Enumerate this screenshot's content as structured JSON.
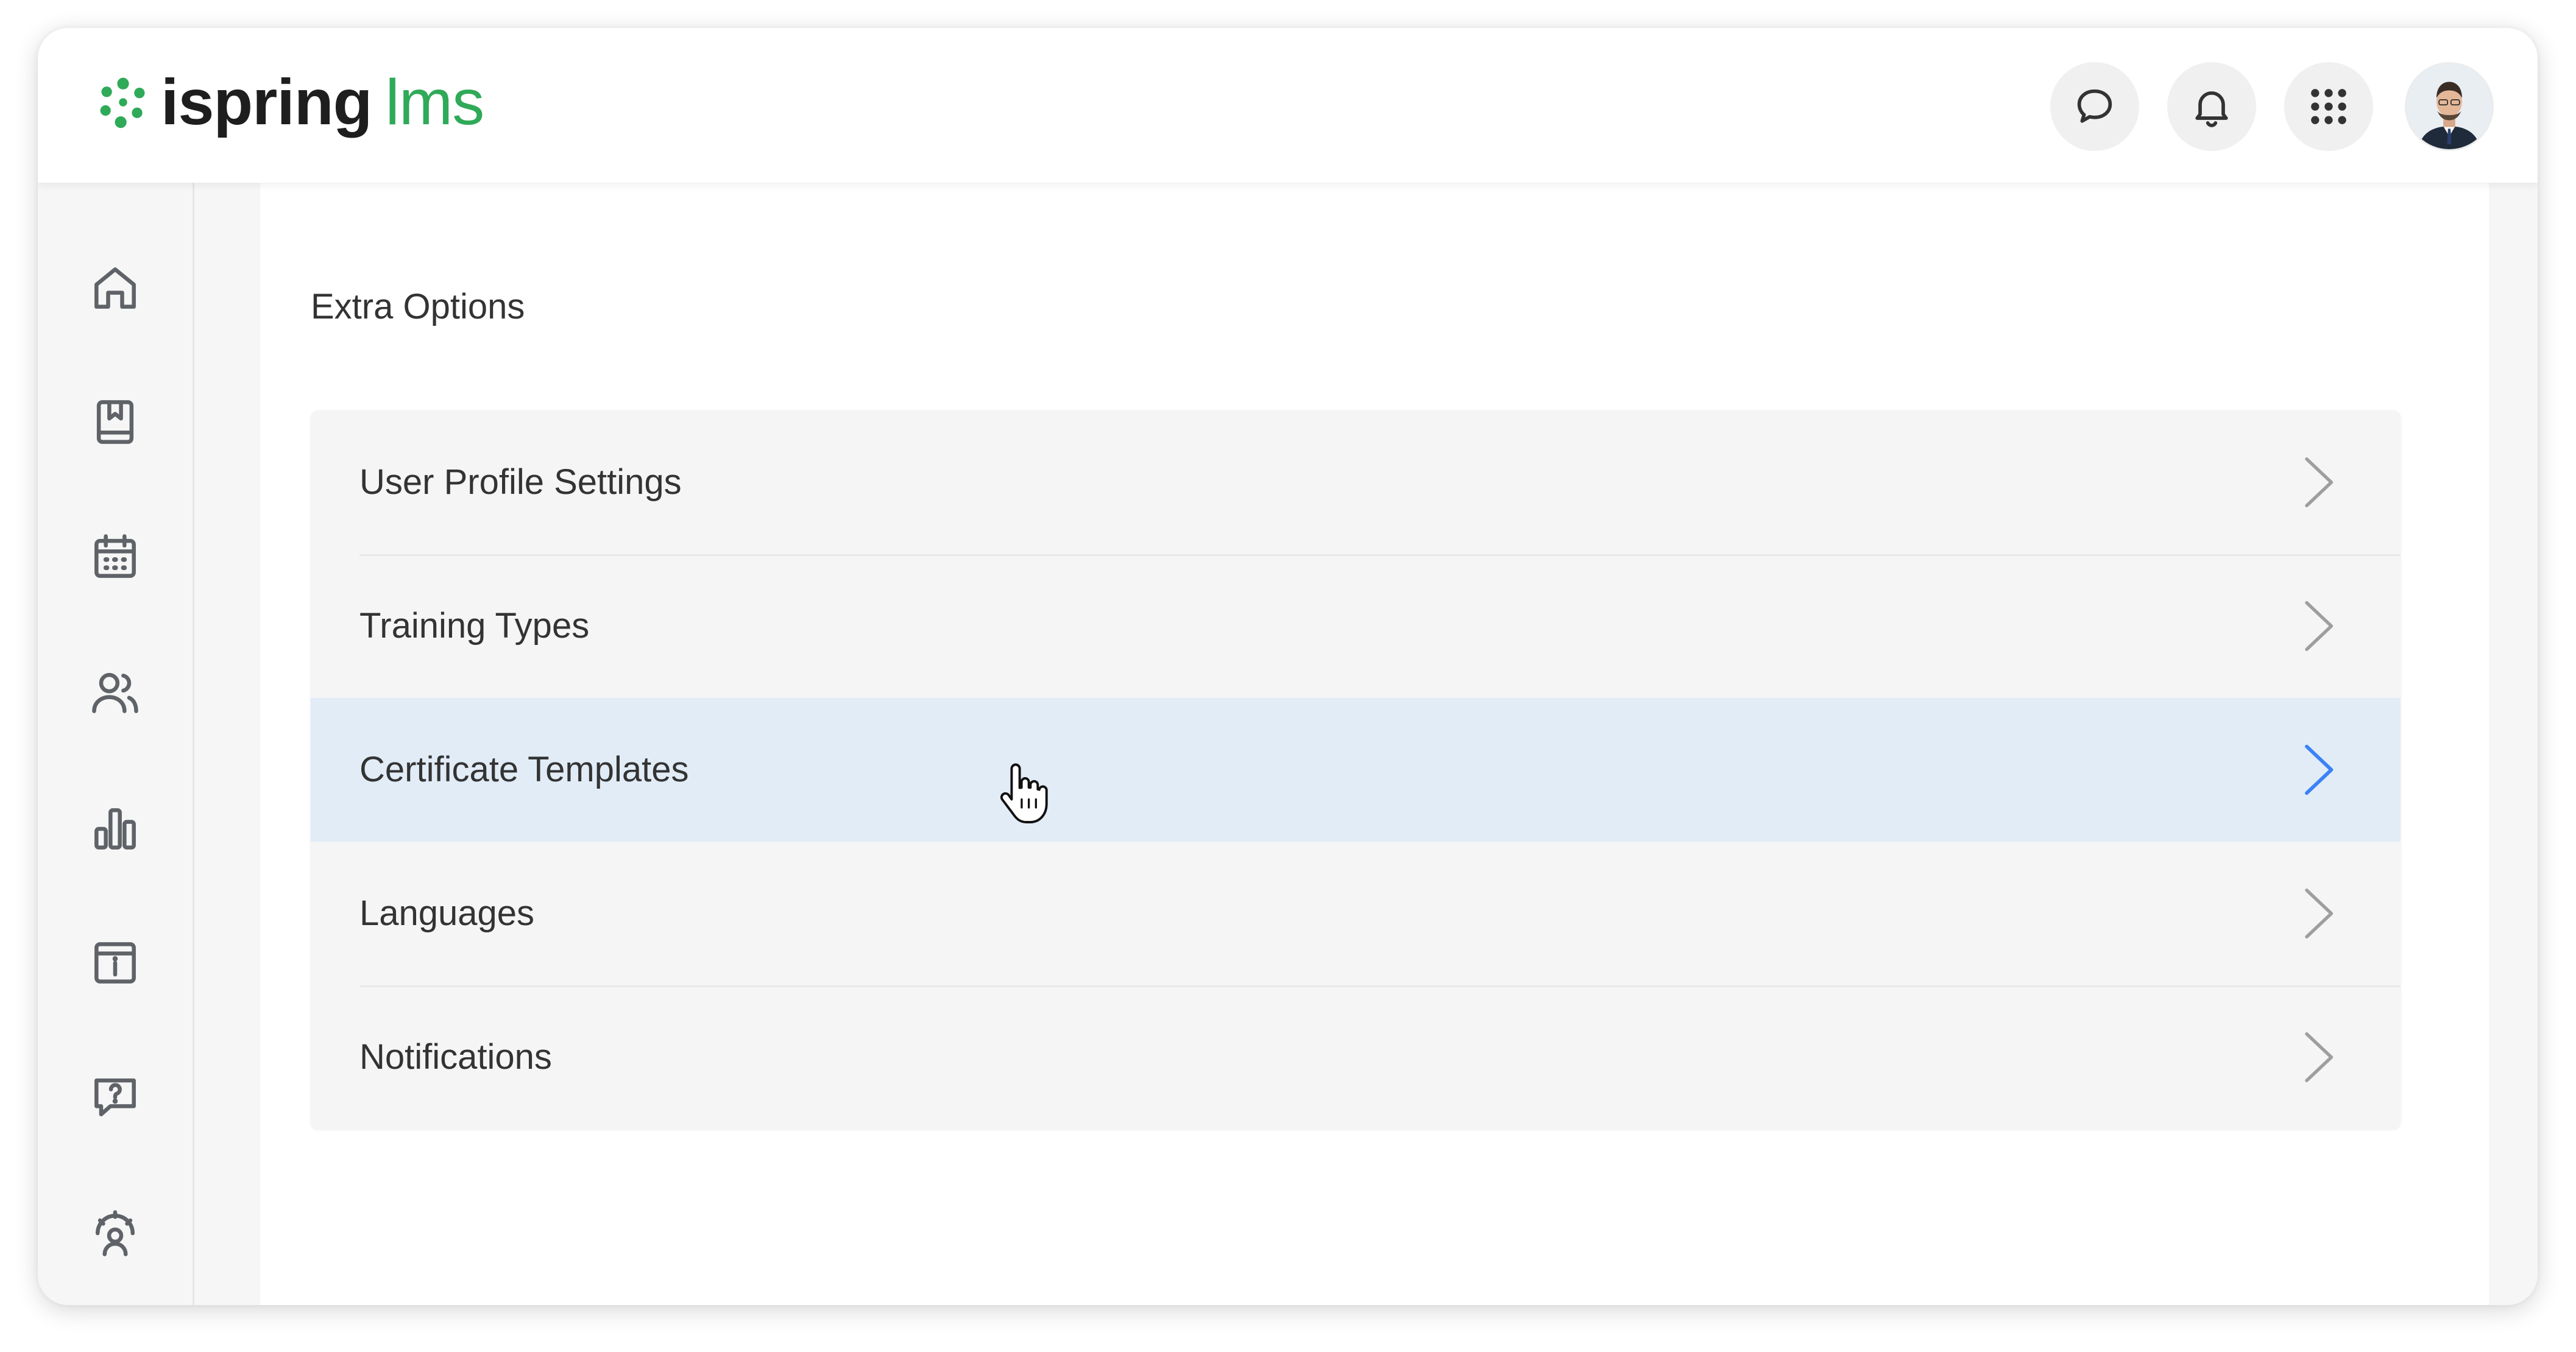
{
  "header": {
    "logo": {
      "part1": "ispring",
      "part2": "lms",
      "icon": "ispring-logo-icon",
      "brand_color": "#2faa58"
    },
    "actions": [
      {
        "name": "chat",
        "icon": "chat-bubble-icon"
      },
      {
        "name": "notifications",
        "icon": "bell-icon"
      },
      {
        "name": "apps",
        "icon": "apps-grid-icon"
      }
    ],
    "avatar": "user-avatar"
  },
  "sidebar": {
    "items": [
      {
        "name": "home",
        "icon": "home-icon"
      },
      {
        "name": "courses",
        "icon": "book-icon"
      },
      {
        "name": "calendar",
        "icon": "calendar-icon"
      },
      {
        "name": "users",
        "icon": "users-icon"
      },
      {
        "name": "reports",
        "icon": "bar-chart-icon"
      },
      {
        "name": "info",
        "icon": "info-icon"
      },
      {
        "name": "help",
        "icon": "help-chat-icon"
      },
      {
        "name": "admin",
        "icon": "admin-user-icon"
      }
    ]
  },
  "main": {
    "section_title": "Extra Options",
    "options": [
      {
        "label": "User Profile Settings",
        "active": false
      },
      {
        "label": "Training Types",
        "active": false
      },
      {
        "label": "Certificate Templates",
        "active": true
      },
      {
        "label": "Languages",
        "active": false
      },
      {
        "label": "Notifications",
        "active": false
      }
    ]
  },
  "colors": {
    "accent": "#3b82f6",
    "active_row": "#e1ecf7",
    "chevron": "#9e9e9e",
    "icon": "#5f6368"
  }
}
